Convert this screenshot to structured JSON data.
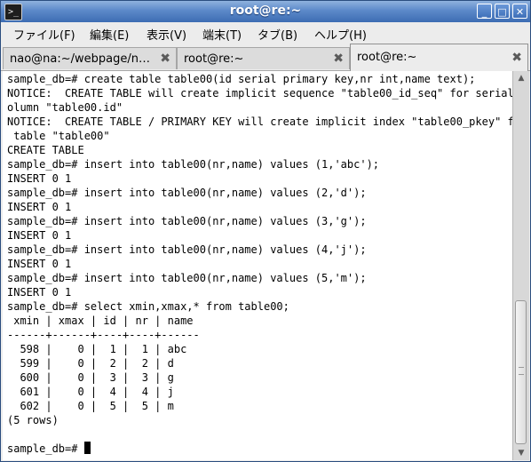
{
  "window": {
    "title": "root@re:~",
    "icon": "terminal-icon"
  },
  "window_buttons": {
    "minimize": "_",
    "maximize": "□",
    "close": "✕"
  },
  "menubar": {
    "items": [
      {
        "label": "ファイル(F)"
      },
      {
        "label": "編集(E)"
      },
      {
        "label": "表示(V)"
      },
      {
        "label": "端末(T)"
      },
      {
        "label": "タブ(B)"
      },
      {
        "label": "ヘルプ(H)"
      }
    ]
  },
  "tabs": [
    {
      "label": "nao@na:~/webpage/n…",
      "close": "✖",
      "active": false
    },
    {
      "label": "root@re:~",
      "close": "✖",
      "active": false
    },
    {
      "label": "root@re:~",
      "close": "✖",
      "active": true
    }
  ],
  "terminal": {
    "lines": [
      "sample_db=# create table table00(id serial primary key,nr int,name text);",
      "NOTICE:  CREATE TABLE will create implicit sequence \"table00_id_seq\" for serial c",
      "olumn \"table00.id\"",
      "NOTICE:  CREATE TABLE / PRIMARY KEY will create implicit index \"table00_pkey\" for",
      " table \"table00\"",
      "CREATE TABLE",
      "sample_db=# insert into table00(nr,name) values (1,'abc');",
      "INSERT 0 1",
      "sample_db=# insert into table00(nr,name) values (2,'d');",
      "INSERT 0 1",
      "sample_db=# insert into table00(nr,name) values (3,'g');",
      "INSERT 0 1",
      "sample_db=# insert into table00(nr,name) values (4,'j');",
      "INSERT 0 1",
      "sample_db=# insert into table00(nr,name) values (5,'m');",
      "INSERT 0 1",
      "sample_db=# select xmin,xmax,* from table00;",
      " xmin | xmax | id | nr | name",
      "------+------+----+----+------",
      "  598 |    0 |  1 |  1 | abc",
      "  599 |    0 |  2 |  2 | d",
      "  600 |    0 |  3 |  3 | g",
      "  601 |    0 |  4 |  4 | j",
      "  602 |    0 |  5 |  5 | m",
      "(5 rows)",
      "",
      "sample_db=# "
    ]
  },
  "scrollbar": {
    "up_icon": "▲",
    "down_icon": "▼"
  }
}
